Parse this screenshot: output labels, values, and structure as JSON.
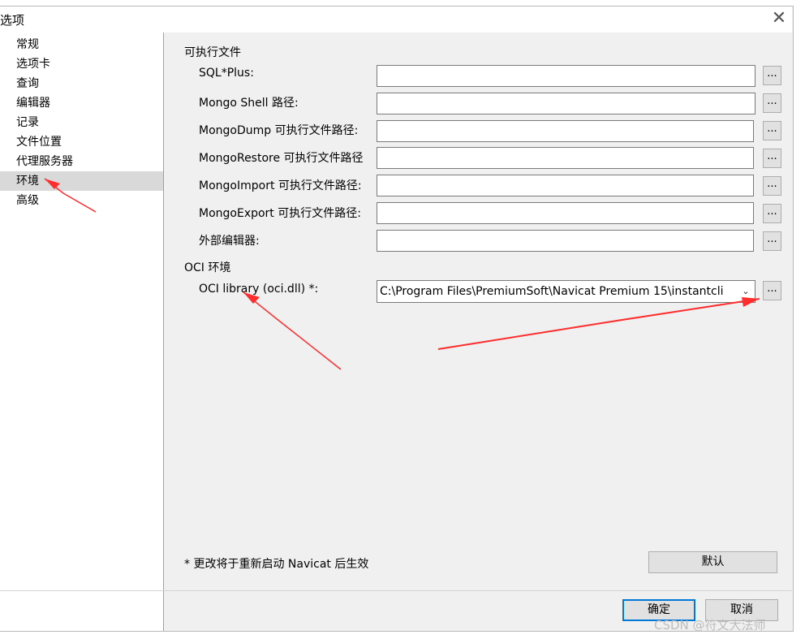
{
  "window": {
    "title": "选项",
    "close_glyph": "✕"
  },
  "sidebar": {
    "items": [
      {
        "label": "常规"
      },
      {
        "label": "选项卡"
      },
      {
        "label": "查询"
      },
      {
        "label": "编辑器"
      },
      {
        "label": "记录"
      },
      {
        "label": "文件位置"
      },
      {
        "label": "代理服务器"
      },
      {
        "label": "环境",
        "selected": true
      },
      {
        "label": "高级"
      }
    ]
  },
  "executables": {
    "section_title": "可执行文件",
    "rows": [
      {
        "label": "SQL*Plus:",
        "value": ""
      },
      {
        "label": "Mongo Shell 路径:",
        "value": ""
      },
      {
        "label": "MongoDump 可执行文件路径:",
        "value": ""
      },
      {
        "label": "MongoRestore 可执行文件路径",
        "value": ""
      },
      {
        "label": "MongoImport 可执行文件路径:",
        "value": ""
      },
      {
        "label": "MongoExport 可执行文件路径:",
        "value": ""
      },
      {
        "label": "外部编辑器:",
        "value": ""
      }
    ],
    "browse_label": "..."
  },
  "oci": {
    "section_title": "OCI 环境",
    "label": "OCI library (oci.dll) *:",
    "value": "C:\\Program Files\\PremiumSoft\\Navicat Premium 15\\instantcli",
    "browse_label": "..."
  },
  "footer": {
    "note": "* 更改将于重新启动 Navicat 后生效",
    "default_button": "默认",
    "ok_button": "确定",
    "cancel_button": "取消"
  },
  "watermark": "CSDN @符文大法师",
  "colors": {
    "annotation_arrow": "#ff2d2d",
    "selected_bg": "#d9d9d9",
    "primary_border": "#0078d7"
  }
}
